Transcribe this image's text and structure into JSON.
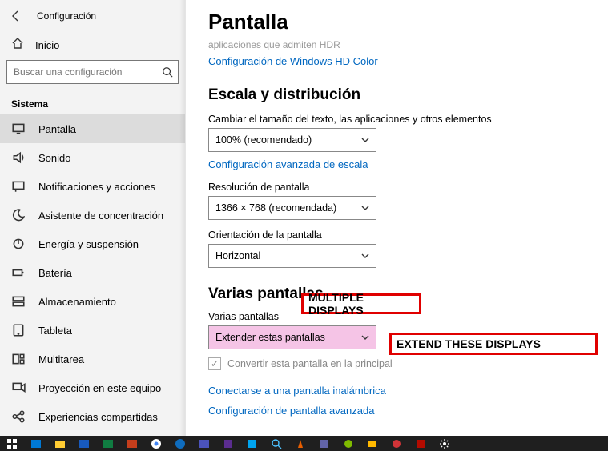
{
  "header": {
    "app_title": "Configuración",
    "home_label": "Inicio"
  },
  "search": {
    "placeholder": "Buscar una configuración"
  },
  "section_label": "Sistema",
  "nav": [
    {
      "id": "pantalla",
      "label": "Pantalla",
      "active": true,
      "icon": "monitor"
    },
    {
      "id": "sonido",
      "label": "Sonido",
      "icon": "speaker"
    },
    {
      "id": "notificaciones",
      "label": "Notificaciones y acciones",
      "icon": "message"
    },
    {
      "id": "concentracion",
      "label": "Asistente de concentración",
      "icon": "moon"
    },
    {
      "id": "energia",
      "label": "Energía y suspensión",
      "icon": "power"
    },
    {
      "id": "bateria",
      "label": "Batería",
      "icon": "battery"
    },
    {
      "id": "almacenamiento",
      "label": "Almacenamiento",
      "icon": "storage"
    },
    {
      "id": "tableta",
      "label": "Tableta",
      "icon": "tablet"
    },
    {
      "id": "multitarea",
      "label": "Multitarea",
      "icon": "multitask"
    },
    {
      "id": "proyeccion",
      "label": "Proyección en este equipo",
      "icon": "project"
    },
    {
      "id": "experiencias",
      "label": "Experiencias compartidas",
      "icon": "share"
    }
  ],
  "page": {
    "title": "Pantalla",
    "clipped_line": "aplicaciones que admiten HDR",
    "hd_color_link": "Configuración de Windows HD Color",
    "scale_heading": "Escala y distribución",
    "scale_label": "Cambiar el tamaño del texto, las aplicaciones y otros elementos",
    "scale_value": "100% (recomendado)",
    "advanced_scale_link": "Configuración avanzada de escala",
    "resolution_label": "Resolución de pantalla",
    "resolution_value": "1366 × 768 (recomendada)",
    "orientation_label": "Orientación de la pantalla",
    "orientation_value": "Horizontal",
    "multi_heading": "Varias pantallas",
    "multi_label": "Varias pantallas",
    "multi_value": "Extender estas pantallas",
    "make_main_label": "Convertir esta pantalla en la principal",
    "wireless_link": "Conectarse a una pantalla inalámbrica",
    "advanced_display_link": "Configuración de pantalla avanzada"
  },
  "annotations": {
    "multiple_displays": "MULTIPLE DISPLAYS",
    "extend_these": "EXTEND THESE DISPLAYS"
  }
}
